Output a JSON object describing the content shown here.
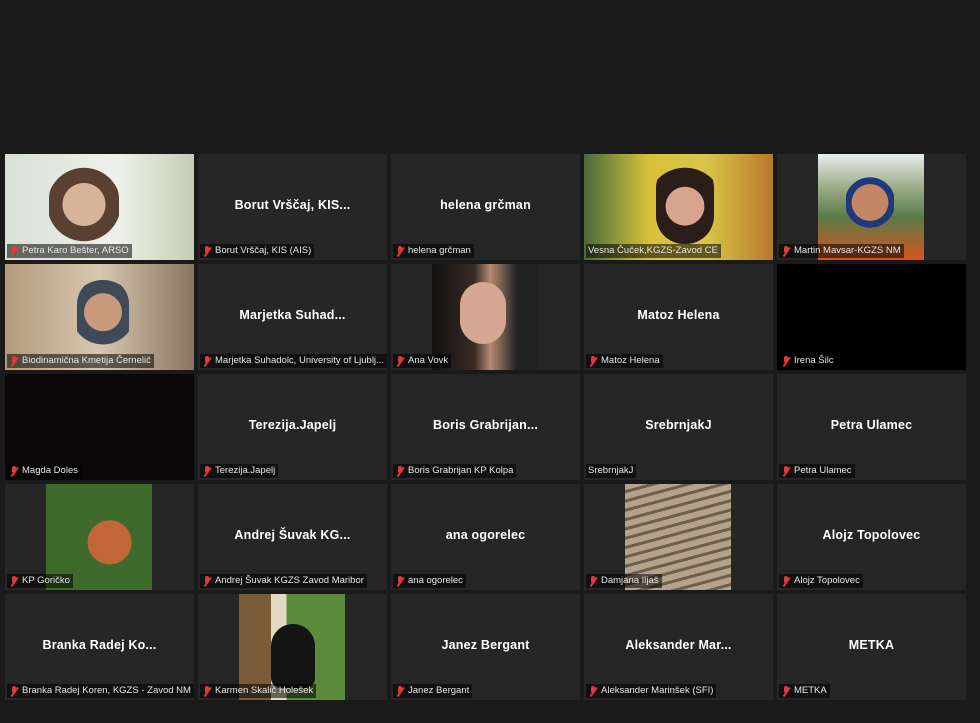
{
  "participants": [
    {
      "display": "",
      "label": "Petra Karo Bešter, ARSO",
      "muted": true,
      "video": "petra-video"
    },
    {
      "display": "Borut Vrščaj, KIS...",
      "label": "Borut Vrščaj, KIS (AIS)",
      "muted": true
    },
    {
      "display": "helena grčman",
      "label": "helena grčman",
      "muted": true
    },
    {
      "display": "",
      "label": "Vesna Čuček,KGZS-Zavod CE",
      "muted": false,
      "active_speaker": true,
      "video": "vesna-video"
    },
    {
      "display": "",
      "label": "Martin Mavsar-KGZS NM",
      "muted": true,
      "video": "martin-avatar"
    },
    {
      "display": "",
      "label": "Biodinamična Kmetija Černelič",
      "muted": true,
      "video": "biodinamicna-video"
    },
    {
      "display": "Marjetka Suhad...",
      "label": "Marjetka Suhadolc, University of Ljublj...",
      "muted": true
    },
    {
      "display": "",
      "label": "Ana Vovk",
      "muted": true,
      "video": "ana-avatar"
    },
    {
      "display": "Matoz Helena",
      "label": "Matoz Helena",
      "muted": true
    },
    {
      "display": "",
      "label": "Irena Šilc",
      "muted": true,
      "video": "black"
    },
    {
      "display": "",
      "label": "Magda Doles",
      "muted": true,
      "video": "black"
    },
    {
      "display": "Terezija.Japelj",
      "label": "Terezija.Japelj",
      "muted": true
    },
    {
      "display": "Boris Grabrijan...",
      "label": "Boris Grabrijan KP Kolpa",
      "muted": true
    },
    {
      "display": "SrebrnjakJ",
      "label": "SrebrnjakJ",
      "muted": false
    },
    {
      "display": "Petra Ulamec",
      "label": "Petra Ulamec",
      "muted": true
    },
    {
      "display": "",
      "label": "KP Goričko",
      "muted": true,
      "video": "kp-avatar"
    },
    {
      "display": "Andrej Šuvak KG...",
      "label": "Andrej Šuvak KGZS Zavod Maribor",
      "muted": true
    },
    {
      "display": "ana ogorelec",
      "label": "ana ogorelec",
      "muted": true
    },
    {
      "display": "",
      "label": "Damjana Iljaš",
      "muted": true,
      "video": "damjana-avatar"
    },
    {
      "display": "Alojz Topolovec",
      "label": "Alojz Topolovec",
      "muted": true
    },
    {
      "display": "Branka Radej Ko...",
      "label": "Branka Radej Koren, KGZS - Zavod NM",
      "muted": true
    },
    {
      "display": "",
      "label": "Karmen Skalič Holešek",
      "muted": true,
      "video": "karmen-avatar"
    },
    {
      "display": "Janez Bergant",
      "label": "Janez Bergant",
      "muted": true
    },
    {
      "display": "Aleksander Mar...",
      "label": "Aleksander Marinšek (SFI)",
      "muted": true
    },
    {
      "display": "METKA",
      "label": "METKA",
      "muted": true
    }
  ],
  "colors": {
    "background": "#1a1a1a",
    "tile": "#262626",
    "active_border": "#c8d63a",
    "muted_icon": "#e03a3a"
  },
  "icons": {
    "muted": "muted-microphone-icon"
  }
}
